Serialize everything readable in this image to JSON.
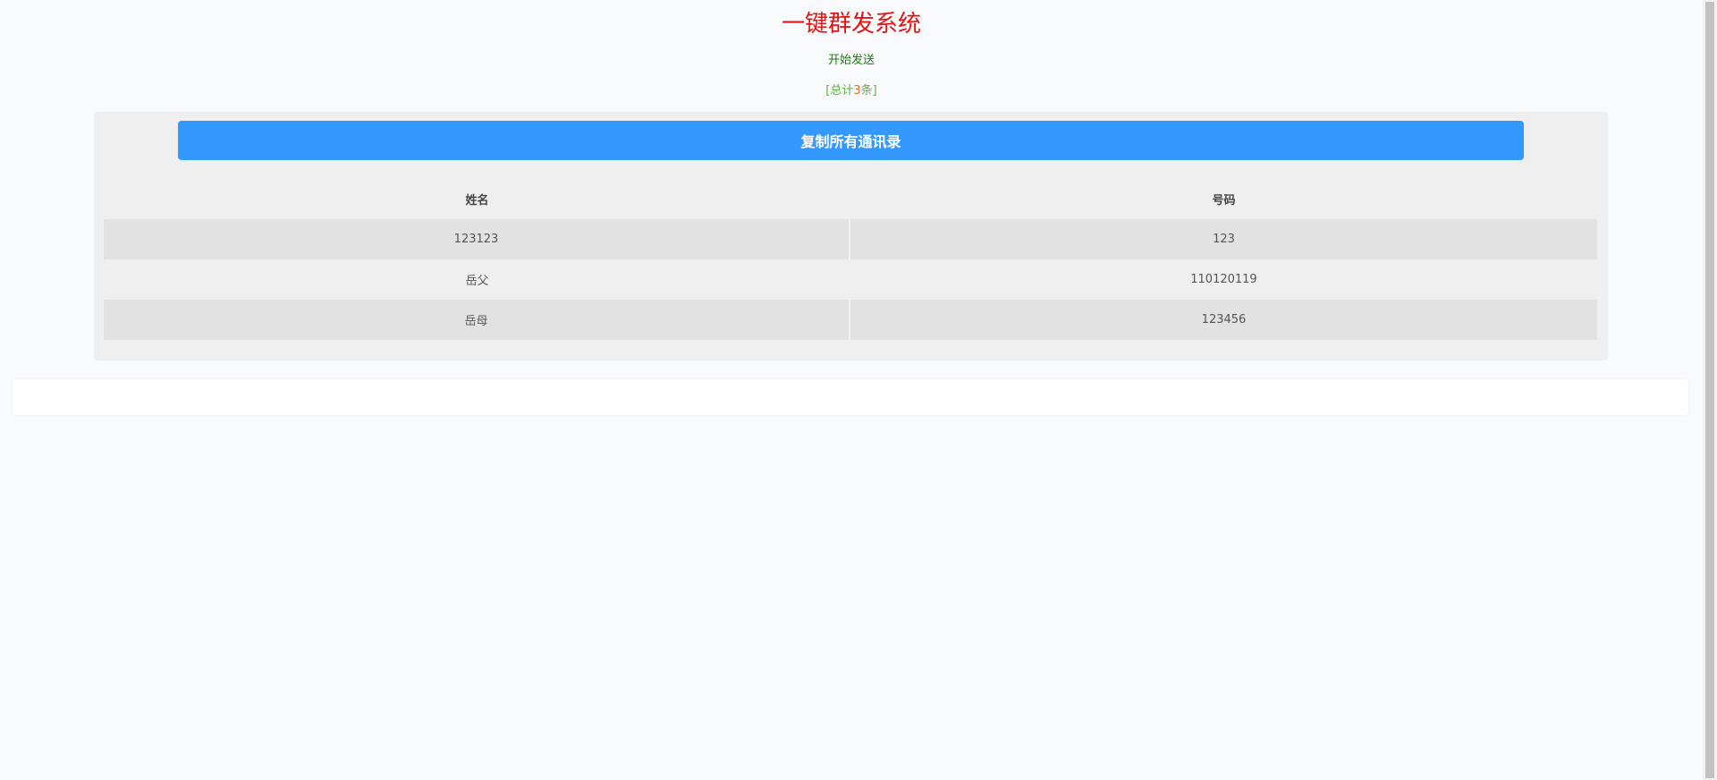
{
  "header": {
    "title": "一键群发系统",
    "start_link": "开始发送",
    "total_prefix": "[总计",
    "total_count": "3",
    "total_suffix": "条]"
  },
  "panel": {
    "copy_button_label": "复制所有通讯录",
    "columns": [
      "姓名",
      "号码"
    ],
    "rows": [
      {
        "name": "123123",
        "phone": "123"
      },
      {
        "name": "岳父",
        "phone": "110120119"
      },
      {
        "name": "岳母",
        "phone": "123456"
      }
    ]
  },
  "colors": {
    "title": "#e01515",
    "start_link": "#1e7a14",
    "total": "#5fae4a",
    "copy_button": "#3399ff"
  }
}
